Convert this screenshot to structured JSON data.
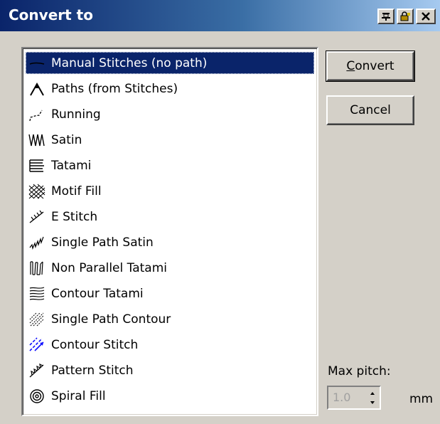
{
  "window": {
    "title": "Convert to"
  },
  "titlebar_buttons": [
    {
      "name": "pin-icon"
    },
    {
      "name": "lock-icon"
    },
    {
      "name": "close-icon"
    }
  ],
  "list": {
    "selected_index": 0,
    "items": [
      {
        "label": "Manual Stitches (no path)",
        "icon": "manual-stitches-icon"
      },
      {
        "label": "Paths (from Stitches)",
        "icon": "paths-icon"
      },
      {
        "label": "Running",
        "icon": "running-icon"
      },
      {
        "label": "Satin",
        "icon": "satin-icon"
      },
      {
        "label": "Tatami",
        "icon": "tatami-icon"
      },
      {
        "label": "Motif Fill",
        "icon": "motif-fill-icon"
      },
      {
        "label": "E Stitch",
        "icon": "e-stitch-icon"
      },
      {
        "label": "Single Path Satin",
        "icon": "single-path-satin-icon"
      },
      {
        "label": "Non Parallel Tatami",
        "icon": "non-parallel-tatami-icon"
      },
      {
        "label": "Contour Tatami",
        "icon": "contour-tatami-icon"
      },
      {
        "label": "Single Path Contour",
        "icon": "single-path-contour-icon"
      },
      {
        "label": "Contour Stitch",
        "icon": "contour-stitch-icon"
      },
      {
        "label": "Pattern Stitch",
        "icon": "pattern-stitch-icon"
      },
      {
        "label": "Spiral Fill",
        "icon": "spiral-fill-icon"
      }
    ]
  },
  "buttons": {
    "convert": {
      "mnemonic": "C",
      "rest": "onvert"
    },
    "cancel": {
      "label": "Cancel"
    }
  },
  "pitch": {
    "label": "Max pitch:",
    "value": "1.0",
    "unit": "mm",
    "enabled": false
  },
  "colors": {
    "selection": "#0a246a",
    "face": "#d4d0c8",
    "title_start": "#0a246a",
    "title_end": "#a6caf0"
  }
}
